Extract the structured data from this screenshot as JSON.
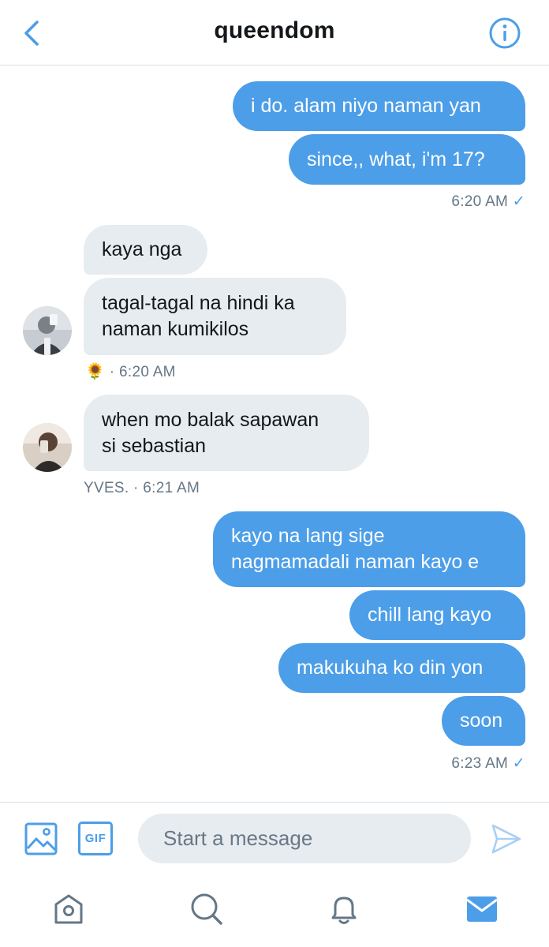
{
  "header": {
    "title": "queendom",
    "back_icon": "chevron-left-icon",
    "info_icon": "info-icon"
  },
  "messages": [
    {
      "dir": "out",
      "text": "i do. alam niyo naman yan"
    },
    {
      "dir": "out",
      "text": "since,, what, i'm 17?"
    },
    {
      "meta": "6:20 AM",
      "check": "✓"
    },
    {
      "dir": "in",
      "text": "kaya nga"
    },
    {
      "dir": "in",
      "lines": [
        "tagal-tagal na hindi ka",
        "naman kumikilos"
      ]
    },
    {
      "meta_emoji": "🌻",
      "meta": "· 6:20 AM"
    },
    {
      "dir": "in",
      "lines": [
        "when mo balak sapawan",
        "si sebastian"
      ]
    },
    {
      "meta": "YVES. · 6:21 AM"
    },
    {
      "dir": "out",
      "lines": [
        "kayo na lang sige",
        "nagmamadali naman kayo e"
      ]
    },
    {
      "dir": "out",
      "text": "chill lang kayo"
    },
    {
      "dir": "out",
      "text": "makukuha ko din yon"
    },
    {
      "dir": "out",
      "text": "soon"
    },
    {
      "meta": "6:23 AM",
      "check": "✓"
    }
  ],
  "composer": {
    "placeholder": "Start a message",
    "gif_label": "GIF",
    "image_icon": "image-icon",
    "send_icon": "send-icon"
  },
  "tabbar": {
    "items": [
      "home-icon",
      "search-icon",
      "notifications-icon",
      "messages-icon"
    ],
    "active": "messages-icon"
  },
  "colors": {
    "accent": "#4c9ee8",
    "incoming_bubble": "#e6ecf0",
    "meta_text": "#657786"
  }
}
